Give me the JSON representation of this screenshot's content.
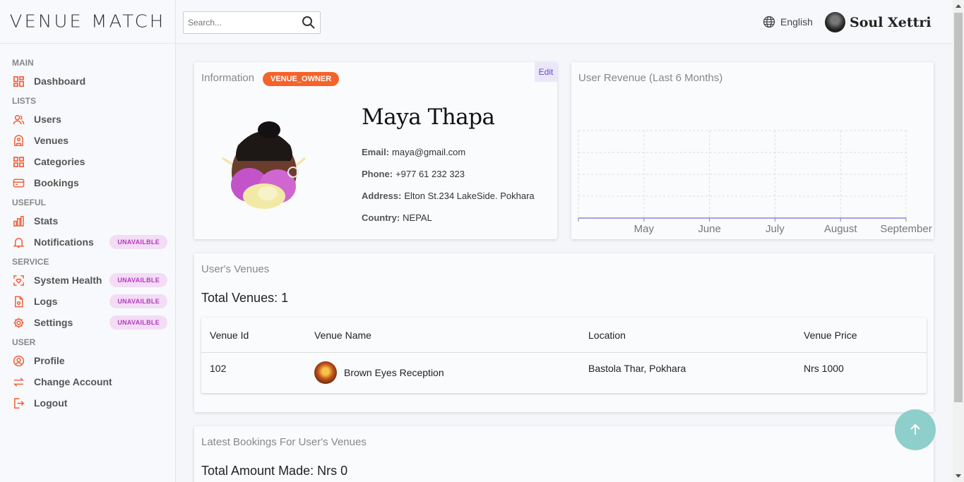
{
  "brand": {
    "name": "VENUE MATCH"
  },
  "search": {
    "placeholder": "Search..."
  },
  "header": {
    "language": "English",
    "user_name": "Soul Xettri"
  },
  "sidebar": {
    "sections": [
      {
        "title": "MAIN",
        "items": [
          {
            "label": "Dashboard",
            "icon": "dashboard-icon"
          }
        ]
      },
      {
        "title": "LISTS",
        "items": [
          {
            "label": "Users",
            "icon": "users-icon"
          },
          {
            "label": "Venues",
            "icon": "venue-icon"
          },
          {
            "label": "Categories",
            "icon": "categories-icon"
          },
          {
            "label": "Bookings",
            "icon": "bookings-icon"
          }
        ]
      },
      {
        "title": "USEFUL",
        "items": [
          {
            "label": "Stats",
            "icon": "stats-icon"
          },
          {
            "label": "Notifications",
            "icon": "bell-icon",
            "badge": "UNAVAILBLE"
          }
        ]
      },
      {
        "title": "SERVICE",
        "items": [
          {
            "label": "System Health",
            "icon": "health-icon",
            "badge": "UNAVAILBLE"
          },
          {
            "label": "Logs",
            "icon": "logs-icon",
            "badge": "UNAVAILBLE"
          },
          {
            "label": "Settings",
            "icon": "gear-icon",
            "badge": "UNAVAILBLE"
          }
        ]
      },
      {
        "title": "USER",
        "items": [
          {
            "label": "Profile",
            "icon": "profile-icon"
          },
          {
            "label": "Change Account",
            "icon": "switch-icon"
          },
          {
            "label": "Logout",
            "icon": "logout-icon"
          }
        ]
      }
    ]
  },
  "info": {
    "title": "Information",
    "role": "VENUE_OWNER",
    "edit": "Edit",
    "name": "Maya Thapa",
    "email_label": "Email:",
    "email": "maya@gmail.com",
    "phone_label": "Phone:",
    "phone": "+977 61 232 323",
    "address_label": "Address:",
    "address": "Elton St.234 LakeSide. Pokhara",
    "country_label": "Country:",
    "country": "NEPAL"
  },
  "revenue": {
    "title": "User Revenue (Last 6 Months)"
  },
  "chart_data": {
    "type": "line",
    "title": "User Revenue (Last 6 Months)",
    "categories": [
      "",
      "May",
      "June",
      "July",
      "August",
      "September"
    ],
    "series": [
      {
        "values": [
          0,
          0,
          0,
          0,
          0,
          0
        ]
      }
    ],
    "grid": true,
    "accent": "#8884d8"
  },
  "venues": {
    "title": "User's Venues",
    "total": "Total Venues: 1",
    "columns": [
      "Venue Id",
      "Venue Name",
      "Location",
      "Venue Price"
    ],
    "rows": [
      {
        "id": "102",
        "name": "Brown Eyes Reception",
        "location": "Bastola Thar, Pokhara",
        "price": "Nrs 1000"
      }
    ]
  },
  "bookings": {
    "title": "Latest Bookings For User's Venues",
    "total": "Total Amount Made: Nrs 0"
  },
  "colors": {
    "accent": "#f5632a",
    "badge_bg": "#f3dcf5",
    "badge_text": "#b43ac0",
    "fab": "#8fcfcb"
  }
}
